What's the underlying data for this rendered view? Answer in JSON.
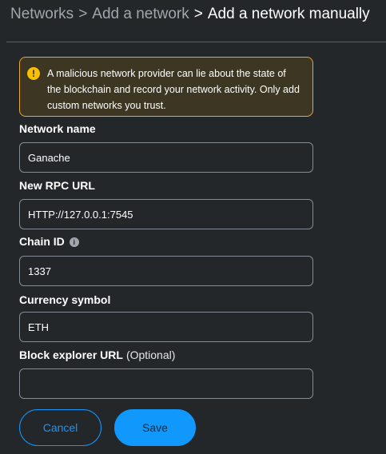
{
  "breadcrumb": {
    "items": [
      "Networks",
      "Add a network"
    ],
    "separator": ">",
    "current": "Add a network manually"
  },
  "warning": {
    "icon": "exclamation-icon",
    "text": "A malicious network provider can lie about the state of the blockchain and record your network activity. Only add custom networks you trust."
  },
  "form": {
    "network_name": {
      "label": "Network name",
      "value": "Ganache"
    },
    "rpc_url": {
      "label": "New RPC URL",
      "value": "HTTP://127.0.0.1:7545"
    },
    "chain_id": {
      "label": "Chain ID",
      "value": "1337",
      "info_icon": "i"
    },
    "currency_symbol": {
      "label": "Currency symbol",
      "value": "ETH"
    },
    "block_explorer": {
      "label": "Block explorer URL",
      "optional": "(Optional)",
      "value": ""
    }
  },
  "buttons": {
    "cancel": "Cancel",
    "save": "Save"
  },
  "colors": {
    "background": "#24272a",
    "accent": "#1098fc",
    "warning_border": "#e8a73a",
    "warning_icon": "#f8c000"
  }
}
